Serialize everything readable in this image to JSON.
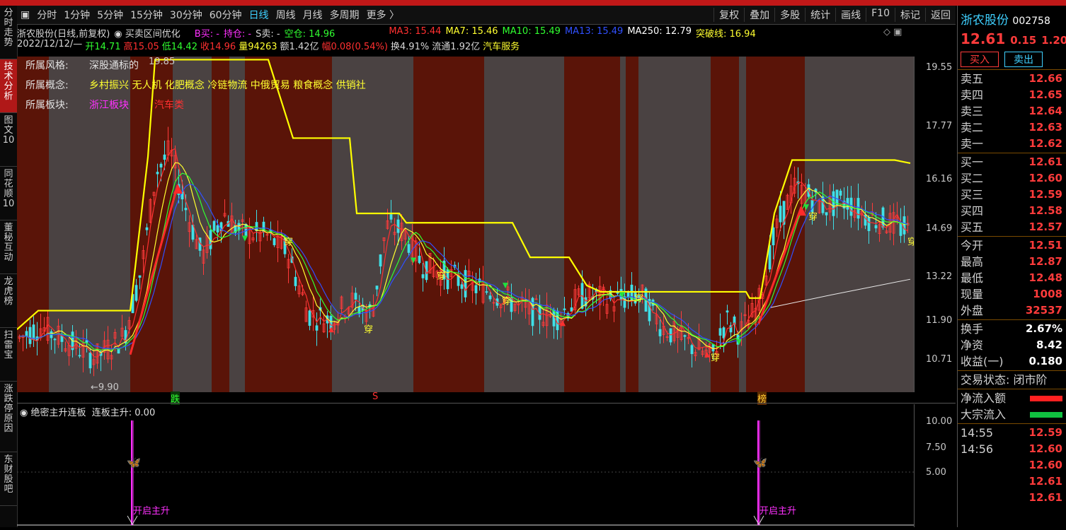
{
  "sidebar": [
    {
      "label": "分时走势",
      "active": false
    },
    {
      "label": "技术分析",
      "active": true
    },
    {
      "label": "图文10",
      "active": false
    },
    {
      "label": "同花顺10",
      "active": false
    },
    {
      "label": "董秘互动",
      "active": false
    },
    {
      "label": "龙虎榜",
      "active": false
    },
    {
      "label": "扫雷宝",
      "active": false
    },
    {
      "label": "涨跌停原因",
      "active": false
    },
    {
      "label": "东财股吧",
      "active": false
    }
  ],
  "periods": [
    "分时",
    "1分钟",
    "5分钟",
    "15分钟",
    "30分钟",
    "60分钟",
    "日线",
    "周线",
    "月线",
    "多周期",
    "更多"
  ],
  "active_period": "日线",
  "tools": [
    "复权",
    "叠加",
    "多股",
    "统计",
    "画线",
    "F10",
    "标记",
    "返回"
  ],
  "header": {
    "title": "浙农股份(日线,前复权)",
    "indicator": "买卖区间优化",
    "b_buy": "B买: -",
    "hold": "持仓: -",
    "s_sell": "S卖: -",
    "empty": "空仓: 14.96",
    "ma3": "MA3: 15.44",
    "ma7": "MA7: 15.46",
    "ma10": "MA10: 15.49",
    "ma13": "MA13: 15.49",
    "ma250": "MA250: 12.79",
    "breakout": "突破线: 16.94"
  },
  "quote_line": {
    "date": "2022/12/12/—",
    "open": "开14.71",
    "high": "高15.05",
    "low": "低14.42",
    "close": "收14.96",
    "volume": "量94263",
    "amount": "额1.42亿",
    "change": "幅0.08(0.54%)",
    "turnover": "换4.91%",
    "float": "流通1.92亿",
    "sector": "汽车服务"
  },
  "overlay": {
    "style_label": "所属风格:",
    "style_value": "深股通标的",
    "concept_label": "所属概念:",
    "concept_value": "乡村振兴 无人机 化肥概念 冷链物流 中俄贸易 粮食概念 供销社",
    "board_label": "所属板块:",
    "board_value": "浙江板块",
    "board_value2": "汽车类"
  },
  "price_axis": [
    "19.55",
    "17.77",
    "16.16",
    "14.69",
    "13.22",
    "11.90",
    "10.71"
  ],
  "chart_labels": {
    "high_mark": "19.85",
    "low_mark": "←9.90",
    "pierce": "穿",
    "bottom_marks": [
      "跌",
      "S",
      "榜"
    ]
  },
  "indicator_panel": {
    "name": "绝密主升连板",
    "value": "连板主升: 0.00",
    "axis": [
      "10.00",
      "7.50",
      "5.00"
    ],
    "signal": "开启主升"
  },
  "right_panel": {
    "name": "浙农股份",
    "code": "002758",
    "price": "12.61",
    "change": "0.15",
    "pct": "1.20",
    "buy_btn": "买入",
    "sell_btn": "卖出",
    "asks": [
      {
        "label": "卖五",
        "price": "12.66"
      },
      {
        "label": "卖四",
        "price": "12.65"
      },
      {
        "label": "卖三",
        "price": "12.64"
      },
      {
        "label": "卖二",
        "price": "12.63"
      },
      {
        "label": "卖一",
        "price": "12.62"
      }
    ],
    "bids": [
      {
        "label": "买一",
        "price": "12.61"
      },
      {
        "label": "买二",
        "price": "12.60"
      },
      {
        "label": "买三",
        "price": "12.59"
      },
      {
        "label": "买四",
        "price": "12.58"
      },
      {
        "label": "买五",
        "price": "12.57"
      }
    ],
    "stats": [
      {
        "label": "今开",
        "value": "12.51"
      },
      {
        "label": "最高",
        "value": "12.87"
      },
      {
        "label": "最低",
        "value": "12.48"
      },
      {
        "label": "现量",
        "value": "1008"
      },
      {
        "label": "外盘",
        "value": "32537"
      }
    ],
    "stats2": [
      {
        "label": "换手",
        "value": "2.67%"
      },
      {
        "label": "净资",
        "value": "8.42"
      },
      {
        "label": "收益(一)",
        "value": "0.180"
      }
    ],
    "trade_status": "交易状态: 闭市阶",
    "flows": [
      {
        "label": "净流入额",
        "color": "#ff2020"
      },
      {
        "label": "大宗流入",
        "color": "#10c040"
      }
    ],
    "ticks": [
      {
        "time": "14:55",
        "price": "12.59"
      },
      {
        "time": "14:56",
        "price": "12.60"
      },
      {
        "time": "",
        "price": "12.60"
      },
      {
        "time": "",
        "price": "12.61"
      },
      {
        "time": "",
        "price": "12.61"
      }
    ]
  },
  "colors": {
    "up": "#ff3b3b",
    "down": "#3fe0e8",
    "zone_red": "#5a1408",
    "zone_gray": "#4a4242"
  }
}
